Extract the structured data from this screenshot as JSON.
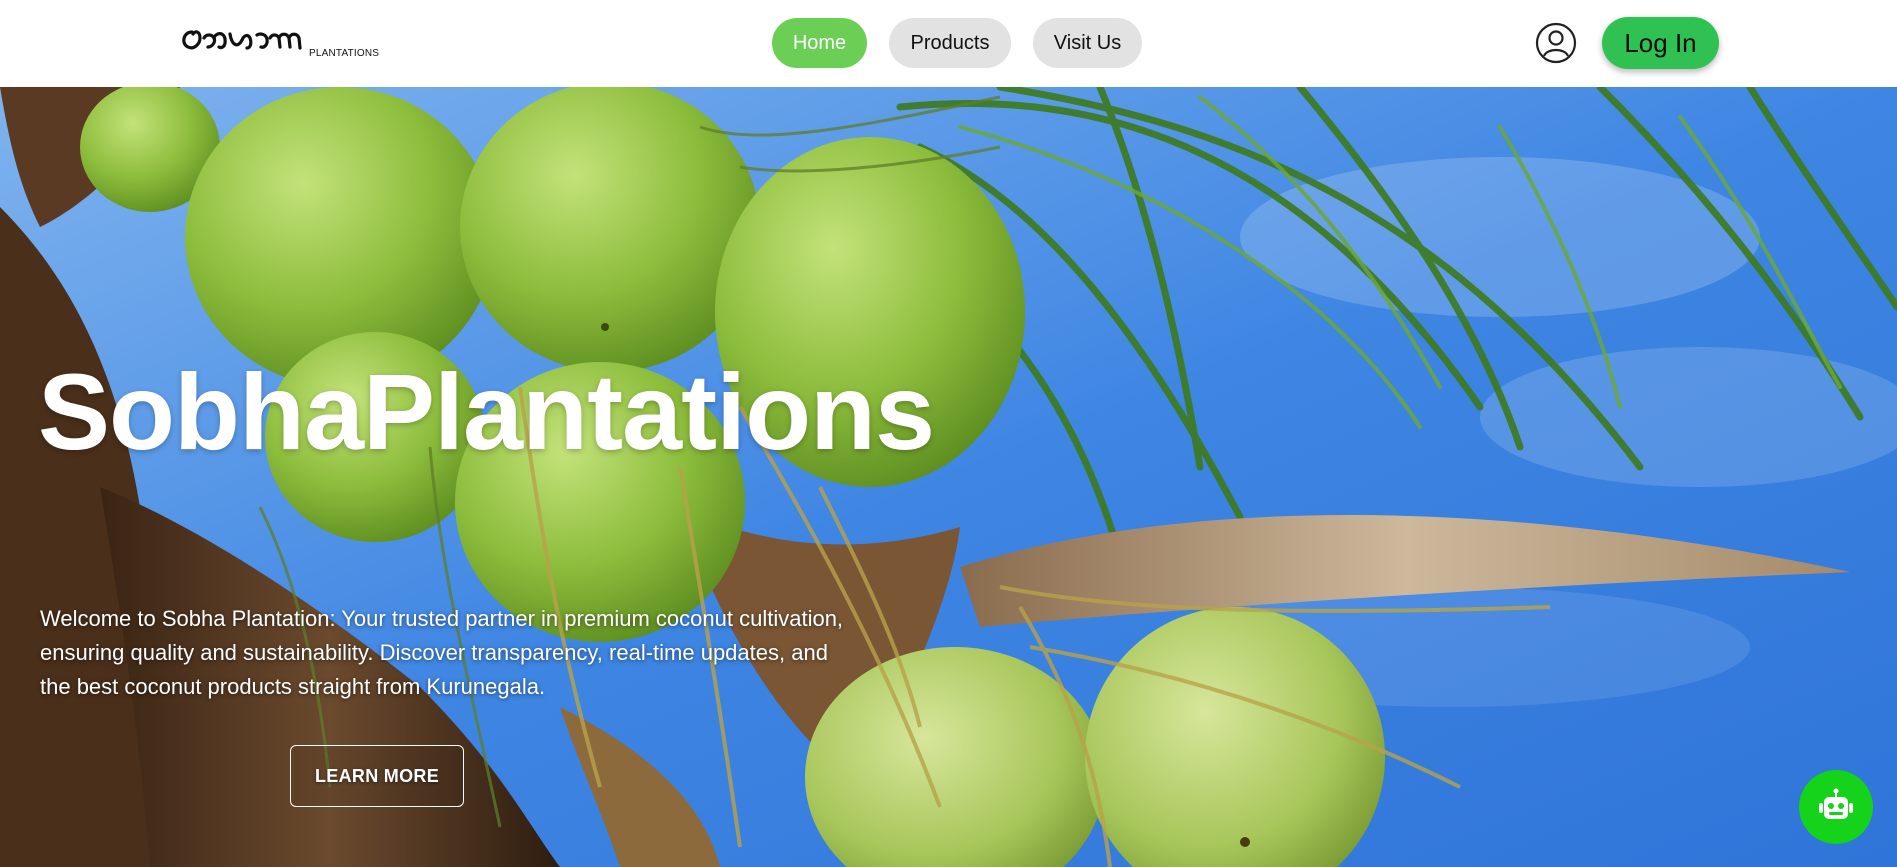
{
  "header": {
    "logo_sub": "PLANTATIONS",
    "nav": [
      {
        "label": "Home",
        "active": true
      },
      {
        "label": "Products",
        "active": false
      },
      {
        "label": "Visit Us",
        "active": false
      }
    ],
    "user_icon": "user-circle-icon",
    "login_label": "Log In"
  },
  "hero": {
    "title": "SobhaPlantations",
    "description": "Welcome to Sobha Plantation: Your trusted partner in premium coconut cultivation, ensuring quality and sustainability. Discover transparency, real-time updates, and the best coconut products straight from Kurunegala.",
    "cta_label": "LEARN MORE",
    "background": "coconut-palm-photo"
  },
  "chatbot": {
    "icon": "robot-icon"
  },
  "colors": {
    "nav_active": "#6ccf55",
    "nav_inactive": "#e2e2e2",
    "login": "#2fc253",
    "chatbot": "#15d21a"
  }
}
